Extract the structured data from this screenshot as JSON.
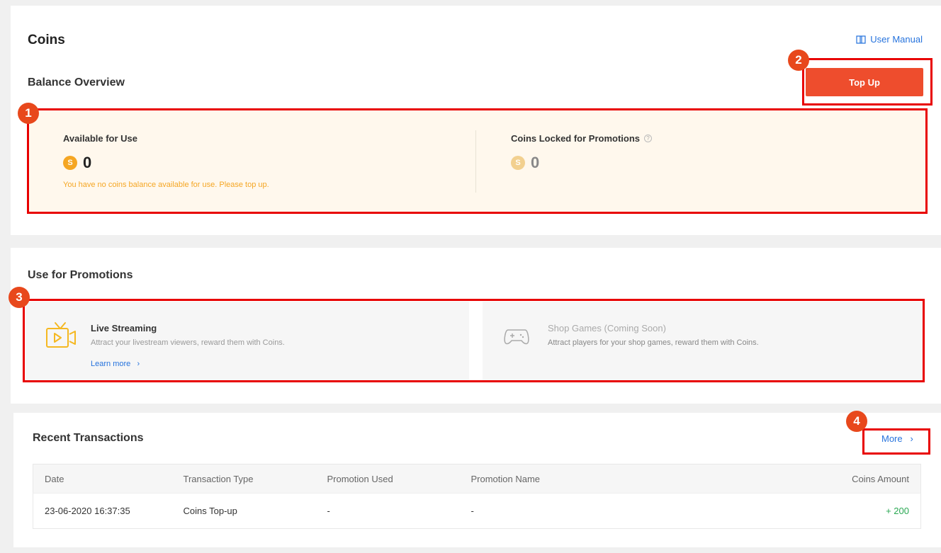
{
  "header": {
    "title": "Coins",
    "user_manual_label": "User Manual"
  },
  "balance": {
    "section_title": "Balance Overview",
    "topup_label": "Top Up",
    "available_label": "Available for Use",
    "available_value": "0",
    "available_note": "You have no coins balance available for use. Please top up.",
    "locked_label": "Coins Locked for Promotions",
    "locked_value": "0",
    "coin_symbol": "S"
  },
  "promotions": {
    "section_title": "Use for Promotions",
    "items": [
      {
        "title": "Live Streaming",
        "description": "Attract your livestream viewers, reward them with Coins.",
        "link_label": "Learn more"
      },
      {
        "title": "Shop Games (Coming Soon)",
        "description": "Attract players for your shop games, reward them with Coins."
      }
    ]
  },
  "transactions": {
    "section_title": "Recent Transactions",
    "more_label": "More",
    "columns": [
      "Date",
      "Transaction Type",
      "Promotion Used",
      "Promotion Name",
      "Coins Amount"
    ],
    "rows": [
      [
        "23-06-2020 16:37:35",
        "Coins Top-up",
        "-",
        "-",
        "+ 200"
      ]
    ]
  },
  "annotations": [
    "1",
    "2",
    "3",
    "4"
  ],
  "colors": {
    "accent": "#ee4d2d",
    "link": "#2673dd",
    "highlight": "#e80000",
    "positive": "#2aa853"
  }
}
